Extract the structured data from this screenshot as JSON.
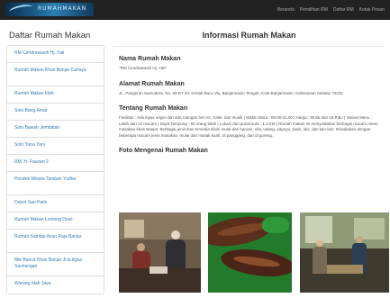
{
  "header": {
    "logo_text": "RUMAHMAKAN",
    "nav": [
      "Beranda",
      "Pemilihan RM",
      "Daftar RM",
      "Kotak Pesan"
    ]
  },
  "sidebar": {
    "title": "Daftar Rumah Makan",
    "items": [
      "RM Cendrawasih Hj. Yati",
      "Rumah Makan Khas Banjar Cahaya",
      "Rumah Makan Idah",
      "Soto Bang Amat",
      "Soto Bawah Jembatan",
      "Soto Yana Yani",
      "RM. H. Fauzan 2",
      "Pondok Wisata Tamban Yudha",
      "Depot Sari Patin",
      "Rumah Makan Lontong Orari",
      "Rumah Sambal Acan Raja Banjar",
      "Mie Bancir Khas Banjar Jl.la Agus Sasirangan",
      "Warung Idah Jaya"
    ]
  },
  "main": {
    "title": "Informasi Rumah Makan",
    "sections": [
      {
        "heading": "Nama Rumah Makan",
        "body": "\"RM Cendrawasih Hj. Yati\""
      },
      {
        "heading": "Alamat Rumah Makan",
        "body": "JL. Pangeran Samudera, No. 65 RT 24, Kertak Baru Ulu, Banjarmasin Tengah, Kota Banjarmasin, Kalimantan Selatan 70231"
      },
      {
        "heading": "Tentang Rumah Makan",
        "body": "Fasilitas : Ada kipas angin dan ada ruangan ber AC, toilet, dan musik | Waktu Buka : 09.00-21.00 | Harga : Mulai dari 15 Ribu | Variasi Menu : Lebih dari 12 macam | Daya Tampung : 55 orang lebih | Lokasi dari pusat kota : 1,3 KM | Rumah makan ini menyediakan berbagai macam menu masakan khas Banjar. Berbagai jenis ikan tersedia disini mulai dari haruan, nila, udang, papuyu, patin, lais, dan lain-lain. Disediakan dengan beberapa macam jenis masakan, mulai dari masak kuah, di panggang, dan di goreng."
      },
      {
        "heading": "Foto Mengenai Rumah Makan",
        "body": ""
      }
    ]
  }
}
